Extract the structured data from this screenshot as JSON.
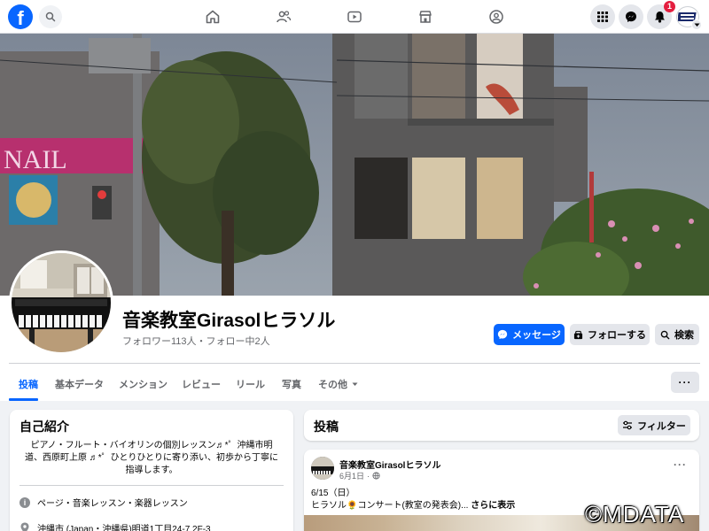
{
  "topbar": {
    "logo_letter": "f",
    "notifications_count": "1",
    "nav_icons": [
      "home-icon",
      "friends-icon",
      "video-icon",
      "marketplace-icon",
      "groups-icon"
    ]
  },
  "page": {
    "name": "音楽教室Girasolヒラソル",
    "stats": "フォロワー113人・フォロー中2人"
  },
  "actions": {
    "message": "メッセージ",
    "follow": "フォローする",
    "search": "検索"
  },
  "tabs": [
    {
      "label": "投稿"
    },
    {
      "label": "基本データ"
    },
    {
      "label": "メンション"
    },
    {
      "label": "レビュー"
    },
    {
      "label": "リール"
    },
    {
      "label": "写真"
    },
    {
      "label": "その他"
    }
  ],
  "more_label": "···",
  "intro": {
    "title": "自己紹介",
    "bio": "ピアノ・フルート・バイオリンの個別レッスン♬*゜沖縄市明道、西原町上原 ♬*゜ひとりひとりに寄り添い、初歩から丁寧に指導します。",
    "category": "ページ・音楽レッスン・楽器レッスン",
    "address": "沖縄市 (Japan・沖縄県)明道1丁目24-7 2F-3"
  },
  "posts": {
    "title": "投稿",
    "filter": "フィルター",
    "item": {
      "author": "音楽教室Girasolヒラソル",
      "date": "6月1日",
      "line1": "6/15（日）",
      "line2": "ヒラソル🌻コンサート(教室の発表会)...",
      "see_more": "さらに表示"
    }
  },
  "watermark": "©MDATA",
  "colors": {
    "brand": "#0866ff",
    "badge": "#e41e3f",
    "secondary_button": "#e4e6eb",
    "background": "#f0f2f5"
  }
}
